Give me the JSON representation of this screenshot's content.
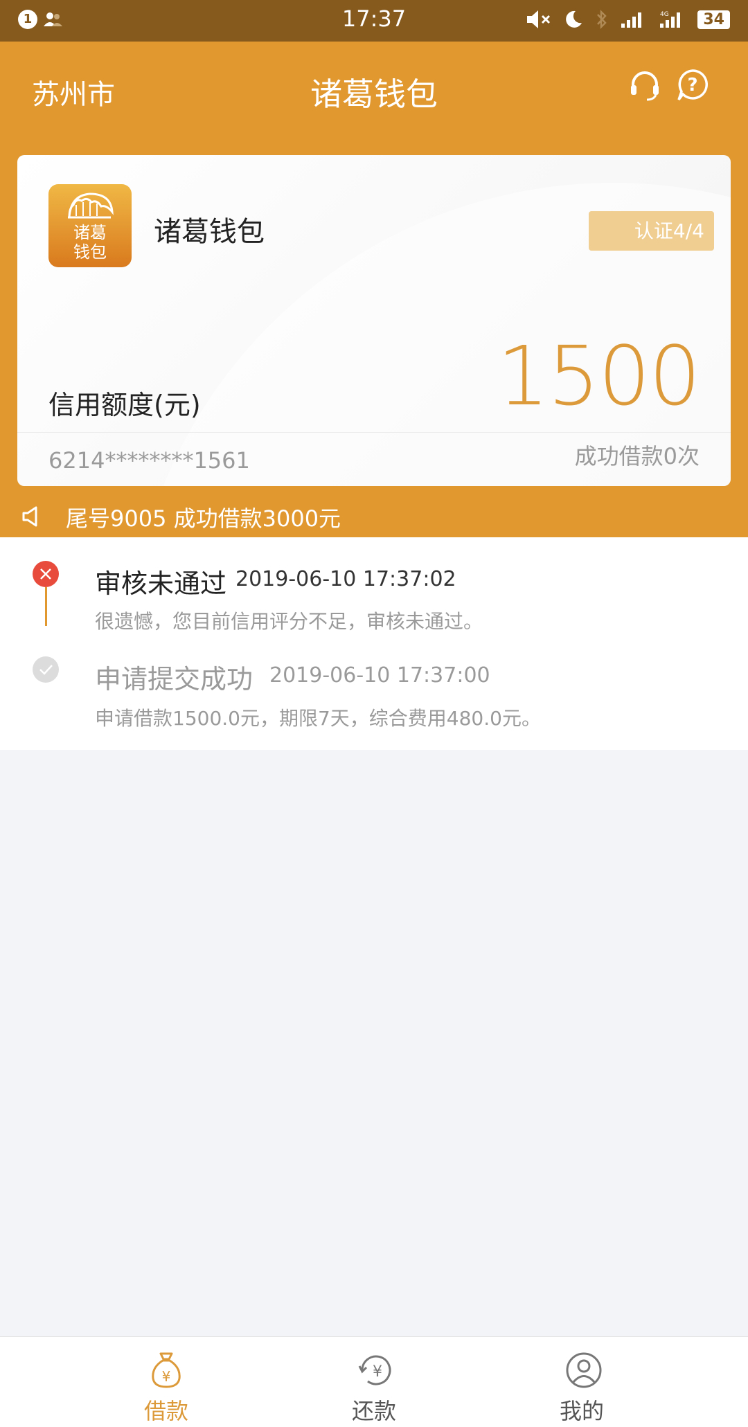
{
  "status_bar": {
    "time": "17:37",
    "notification_count": "1",
    "battery": "34"
  },
  "header": {
    "city": "苏州市",
    "title": "诸葛钱包"
  },
  "card": {
    "logo_text": "诸葛钱包",
    "app_name": "诸葛钱包",
    "certification": "认证4/4",
    "credit_label": "信用额度(元)",
    "credit_amount": "1500",
    "card_number": "6214********1561",
    "loan_count": "成功借款0次"
  },
  "notice": {
    "text": "尾号9005 成功借款3000元"
  },
  "timeline": [
    {
      "status": "审核未通过",
      "time": "2019-06-10 17:37:02",
      "description": "很遗憾，您目前信用评分不足，审核未通过。",
      "state": "rejected"
    },
    {
      "status": "申请提交成功",
      "time": "2019-06-10 17:37:00",
      "description": "申请借款1500.0元，期限7天，综合费用480.0元。",
      "state": "done"
    }
  ],
  "tabs": [
    {
      "label": "借款",
      "icon": "money-bag-icon",
      "active": true
    },
    {
      "label": "还款",
      "icon": "repay-icon",
      "active": false
    },
    {
      "label": "我的",
      "icon": "user-icon",
      "active": false
    }
  ],
  "colors": {
    "primary": "#e0982f",
    "status_bar": "#86591c",
    "accent_text": "#dc9a3a",
    "error": "#e84b3c"
  }
}
